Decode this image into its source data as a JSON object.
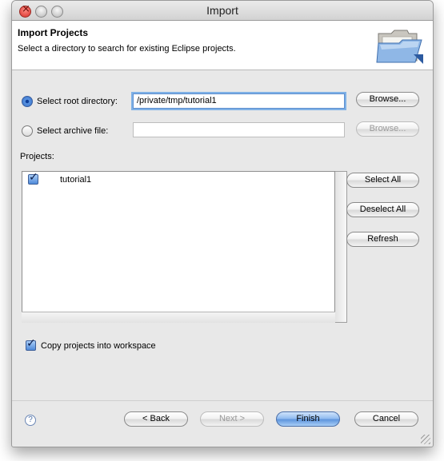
{
  "window": {
    "title": "Import"
  },
  "header": {
    "title": "Import Projects",
    "description": "Select a directory to search for existing Eclipse projects.",
    "icon": "folder-icon"
  },
  "source": {
    "root_dir_label": "Select root directory:",
    "root_dir_value": "/private/tmp/tutorial1",
    "root_dir_selected": true,
    "archive_label": "Select archive file:",
    "archive_value": "",
    "archive_selected": false,
    "browse_label": "Browse...",
    "browse_archive_label": "Browse..."
  },
  "projects": {
    "label": "Projects:",
    "items": [
      {
        "name": "tutorial1",
        "checked": true
      }
    ],
    "select_all": "Select All",
    "deselect_all": "Deselect All",
    "refresh": "Refresh"
  },
  "options": {
    "copy_label": "Copy projects into workspace",
    "copy_checked": true
  },
  "footer": {
    "help_icon": "help-icon",
    "back": "< Back",
    "next": "Next >",
    "finish": "Finish",
    "cancel": "Cancel"
  },
  "colors": {
    "accent": "#5f95dd",
    "window_bg": "#e8e8e8"
  }
}
